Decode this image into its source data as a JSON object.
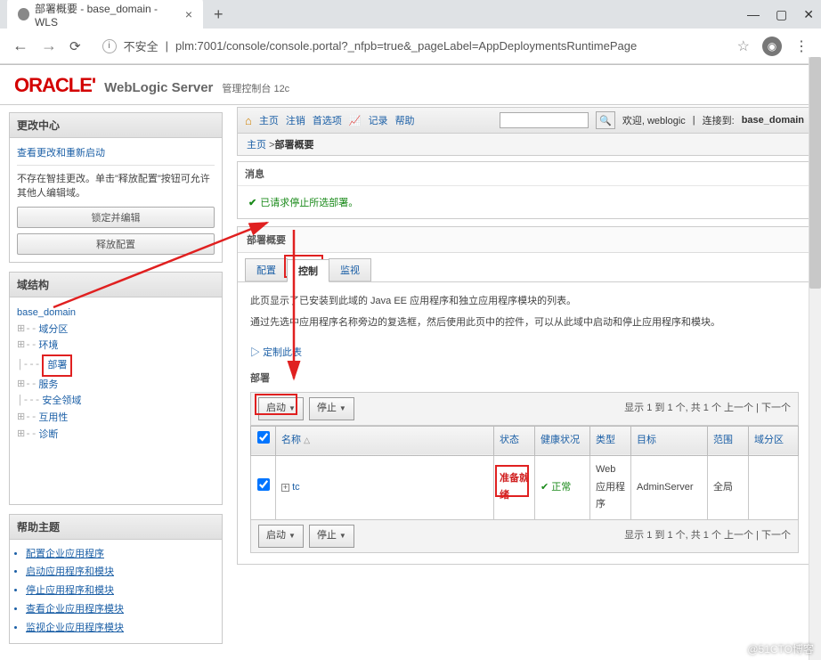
{
  "browser": {
    "tab_title": "部署概要 - base_domain - WLS",
    "url_prefix": "不安全",
    "url": "plm:7001/console/console.portal?_nfpb=true&_pageLabel=AppDeploymentsRuntimePage"
  },
  "oracle": {
    "logo": "ORACLE'",
    "prod": "WebLogic Server",
    "ver": "管理控制台 12c"
  },
  "toolbar": {
    "items": [
      "主页",
      "注销",
      "首选项",
      "记录",
      "帮助"
    ],
    "welcome": "欢迎, weblogic",
    "connected": "连接到:",
    "domain": "base_domain"
  },
  "breadcrumb": {
    "home": "主页",
    "sep": " >",
    "current": "部署概要"
  },
  "change_center": {
    "title": "更改中心",
    "view_link": "查看更改和重新启动",
    "note": "不存在智挂更改。单击\"释放配置\"按钮可允许其他人编辑域。",
    "btn_lock": "锁定并编辑",
    "btn_release": "释放配置"
  },
  "tree": {
    "title": "域结构",
    "root": "base_domain",
    "items": [
      "域分区",
      "环境",
      "部署",
      "服务",
      "安全领域",
      "互用性",
      "诊断"
    ]
  },
  "help": {
    "title": "帮助主题",
    "items": [
      "配置企业应用程序",
      "启动应用程序和模块",
      "停止应用程序和模块",
      "查看企业应用程序模块",
      "监视企业应用程序模块"
    ]
  },
  "messages": {
    "title": "消息",
    "ok_text": "已请求停止所选部署。"
  },
  "section": {
    "title": "部署概要",
    "tabs": [
      "配置",
      "控制",
      "监视"
    ],
    "active_tab": 1,
    "p1": "此页显示了已安装到此域的 Java EE 应用程序和独立应用程序模块的列表。",
    "p2": "通过先选中应用程序名称旁边的复选框，然后使用此页中的控件，可以从此域中启动和停止应用程序和模块。",
    "customize": "定制此表",
    "dep_label": "部署",
    "btn_start": "启动",
    "btn_stop": "停止",
    "paging": "显示 1 到 1 个, 共 1 个   上一个 | 下一个"
  },
  "table": {
    "columns": [
      "",
      "名称",
      "状态",
      "健康状况",
      "类型",
      "目标",
      "范围",
      "域分区"
    ],
    "row": {
      "name": "tc",
      "state": "准备就绪",
      "health": "正常",
      "type": "Web 应用程序",
      "target": "AdminServer",
      "scope": "全局",
      "part": ""
    }
  },
  "watermark": "@51CTO博客"
}
